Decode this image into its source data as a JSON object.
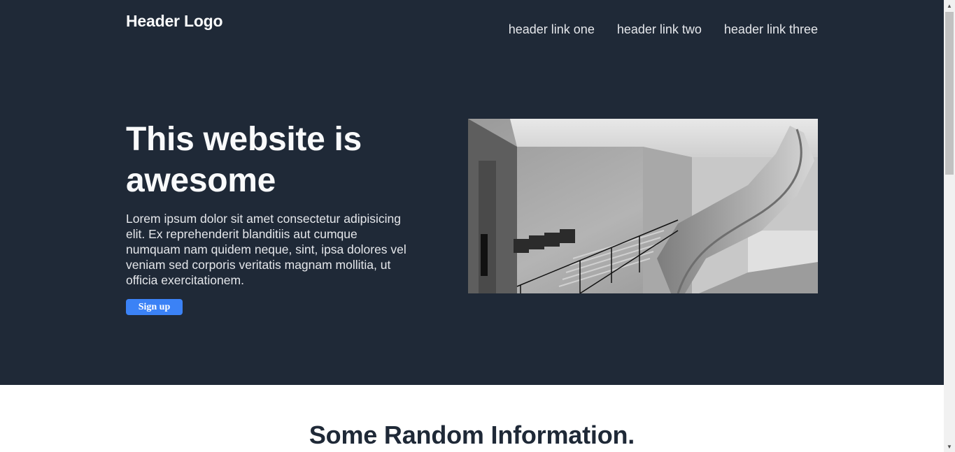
{
  "header": {
    "logo": "Header Logo",
    "links": [
      "header link one",
      "header link two",
      "header link three"
    ]
  },
  "hero": {
    "title": "This website is awesome",
    "text": "Lorem ipsum dolor sit amet consectetur adipisicing elit. Ex reprehenderit blanditiis aut cumque numquam nam quidem neque, sint, ipsa dolores vel veniam sed corporis veritatis magnam mollitia, ut officia exercitationem.",
    "button_label": "Sign up",
    "image_icon": "architecture-staircase-photo"
  },
  "section": {
    "title": "Some Random Information."
  },
  "colors": {
    "hero_bg": "#1f2937",
    "button": "#3b82f6",
    "section_title": "#1f2937"
  },
  "scrollbar": {
    "up_icon": "triangle-up-icon",
    "down_icon": "triangle-down-icon"
  }
}
